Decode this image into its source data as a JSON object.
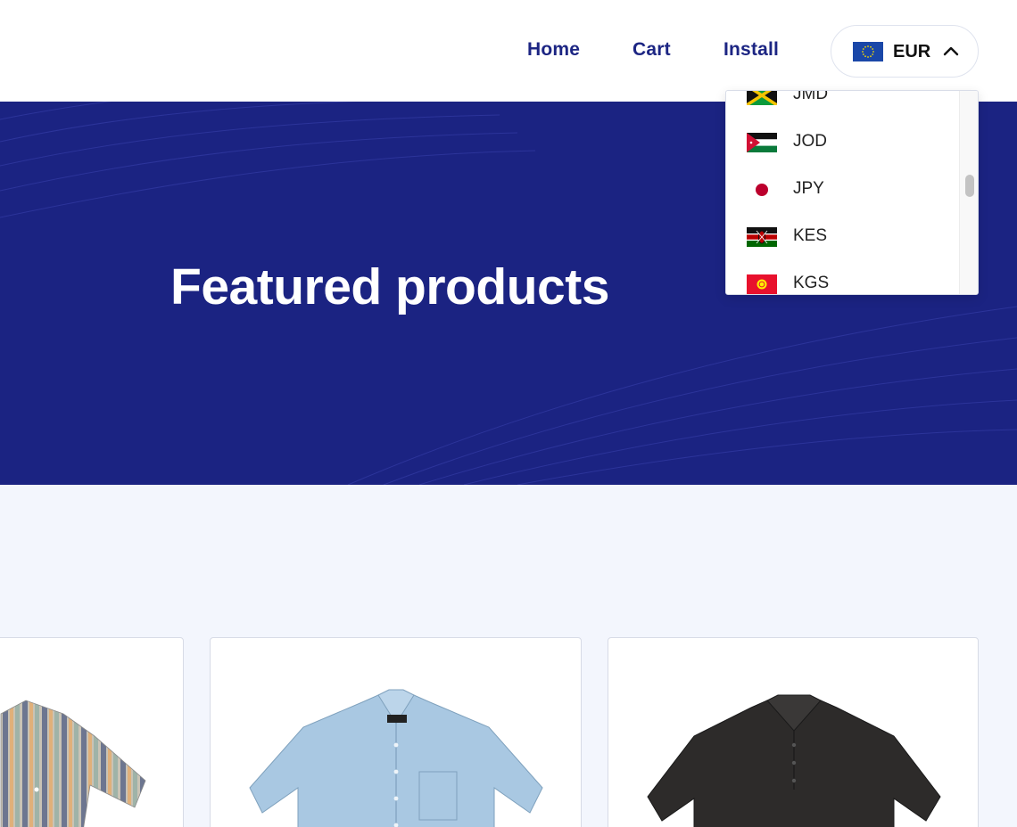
{
  "nav": {
    "home": "Home",
    "cart": "Cart",
    "install": "Install"
  },
  "currency": {
    "selected": "EUR",
    "flag_icon": "eu-flag-icon",
    "options": [
      {
        "code": "JMD",
        "flag": "jamaica-flag-icon"
      },
      {
        "code": "JOD",
        "flag": "jordan-flag-icon"
      },
      {
        "code": "JPY",
        "flag": "japan-flag-icon"
      },
      {
        "code": "KES",
        "flag": "kenya-flag-icon"
      },
      {
        "code": "KGS",
        "flag": "kyrgyzstan-flag-icon"
      }
    ]
  },
  "hero": {
    "title": "Featured products"
  },
  "products": [
    {
      "image": "striped-shirt-image"
    },
    {
      "image": "light-blue-shirt-image"
    },
    {
      "image": "black-polo-image"
    }
  ],
  "colors": {
    "brand_navy": "#1b2382",
    "nav_text": "#1c2583",
    "page_bg": "#f3f6fd"
  }
}
